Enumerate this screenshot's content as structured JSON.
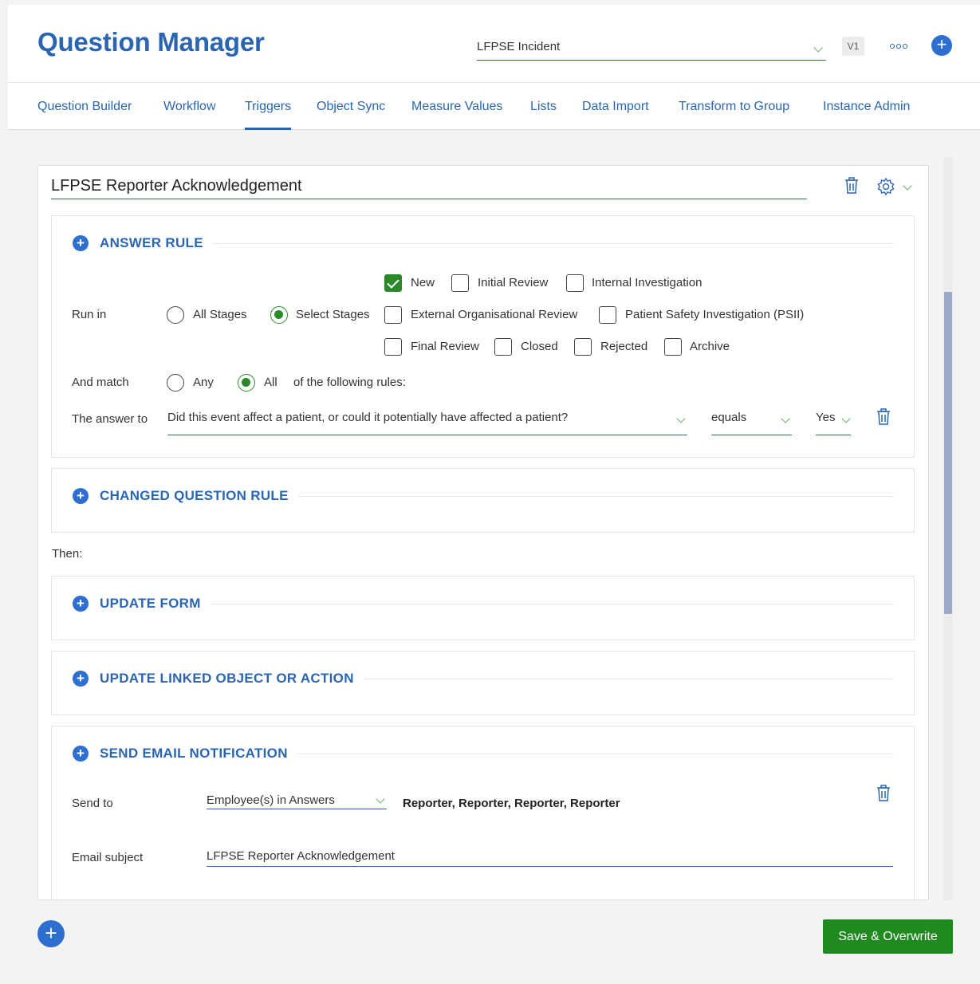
{
  "app": {
    "title": "Question Manager"
  },
  "header": {
    "form_selected": "LFPSE Incident",
    "version": "V1"
  },
  "nav": {
    "tabs": [
      {
        "label": "Question Builder"
      },
      {
        "label": "Workflow"
      },
      {
        "label": "Triggers",
        "active": true
      },
      {
        "label": "Object Sync"
      },
      {
        "label": "Measure Values"
      },
      {
        "label": "Lists"
      },
      {
        "label": "Data Import"
      },
      {
        "label": "Transform to Group"
      },
      {
        "label": "Instance Admin"
      }
    ]
  },
  "trigger": {
    "name": "LFPSE Reporter Acknowledgement",
    "answer_rule": {
      "title": "ANSWER RULE",
      "run_in_label": "Run in",
      "run_in_options": [
        {
          "label": "All Stages",
          "selected": false
        },
        {
          "label": "Select Stages",
          "selected": true
        }
      ],
      "stages": [
        {
          "label": "New",
          "checked": true
        },
        {
          "label": "Initial Review",
          "checked": false
        },
        {
          "label": "Internal Investigation",
          "checked": false
        },
        {
          "label": "External Organisational Review",
          "checked": false
        },
        {
          "label": "Patient Safety Investigation (PSII)",
          "checked": false
        },
        {
          "label": "Final Review",
          "checked": false
        },
        {
          "label": "Closed",
          "checked": false
        },
        {
          "label": "Rejected",
          "checked": false
        },
        {
          "label": "Archive",
          "checked": false
        }
      ],
      "match_label": "And match",
      "match_options": [
        {
          "label": "Any",
          "selected": false
        },
        {
          "label": "All",
          "selected": true
        }
      ],
      "match_suffix": "of the following rules:",
      "answer_to_label": "The answer to",
      "question": "Did this event affect a patient, or could it potentially have affected a patient?",
      "operator": "equals",
      "value": "Yes"
    },
    "changed_question_rule": {
      "title": "CHANGED QUESTION RULE"
    },
    "then_label": "Then:",
    "update_form": {
      "title": "UPDATE FORM"
    },
    "update_linked": {
      "title": "UPDATE LINKED OBJECT OR ACTION"
    },
    "send_email": {
      "title": "SEND EMAIL NOTIFICATION",
      "send_to_label": "Send to",
      "send_to_value": "Employee(s) in Answers",
      "recipients": "Reporter, Reporter, Reporter, Reporter",
      "subject_label": "Email subject",
      "subject_value": "LFPSE Reporter Acknowledgement"
    }
  },
  "footer": {
    "save_label": "Save & Overwrite"
  },
  "colors": {
    "accent": "#2a65b1",
    "success": "#1f8a1f",
    "plus": "#2d6fd0"
  }
}
